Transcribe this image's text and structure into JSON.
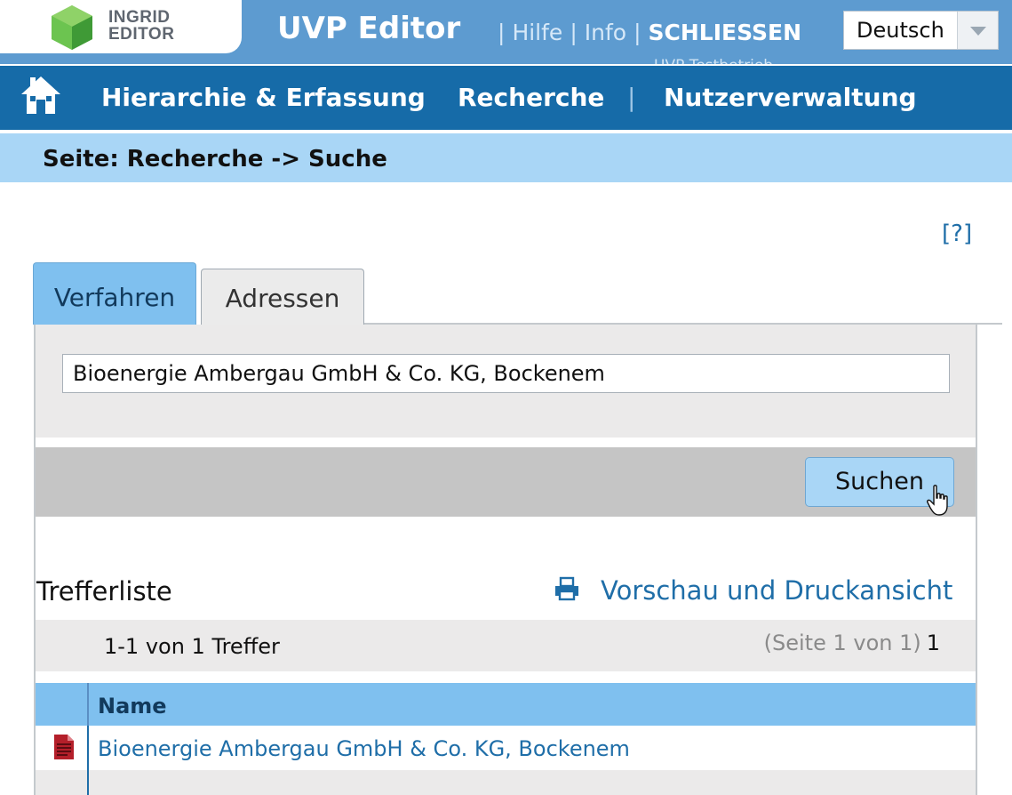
{
  "header": {
    "logo_line1": "INGRID",
    "logo_line2": "EDITOR",
    "app_title": "UVP Editor",
    "links": [
      "Hilfe",
      "Info"
    ],
    "close_label": "SCHLIESSEN",
    "language": "Deutsch",
    "user_hint": "UVP Testbetrieb"
  },
  "nav": {
    "home_icon": "home-icon",
    "items": [
      "Hierarchie & Erfassung",
      "Recherche",
      "Nutzerverwaltung"
    ]
  },
  "breadcrumb": "Seite: Recherche -> Suche",
  "help_label": "[?]",
  "tabs": [
    {
      "label": "Verfahren",
      "active": true
    },
    {
      "label": "Adressen",
      "active": false
    }
  ],
  "search": {
    "value": "Bioenergie Ambergau GmbH & Co. KG, Bockenem",
    "button_label": "Suchen"
  },
  "results": {
    "title": "Trefferliste",
    "print_label": "Vorschau und Druckansicht",
    "count_text": "1-1 von 1 Treffer",
    "page_info": "(Seite 1 von 1)",
    "page_number": "1",
    "columns": [
      "Name"
    ],
    "rows": [
      {
        "name": "Bioenergie Ambergau GmbH & Co. KG, Bockenem"
      }
    ]
  },
  "colors": {
    "header_bg": "#5d9bd0",
    "nav_bg": "#166ba8",
    "crumb_bg": "#a9d6f6",
    "accent": "#1f6ea8",
    "tab_active": "#7fc0ef"
  }
}
